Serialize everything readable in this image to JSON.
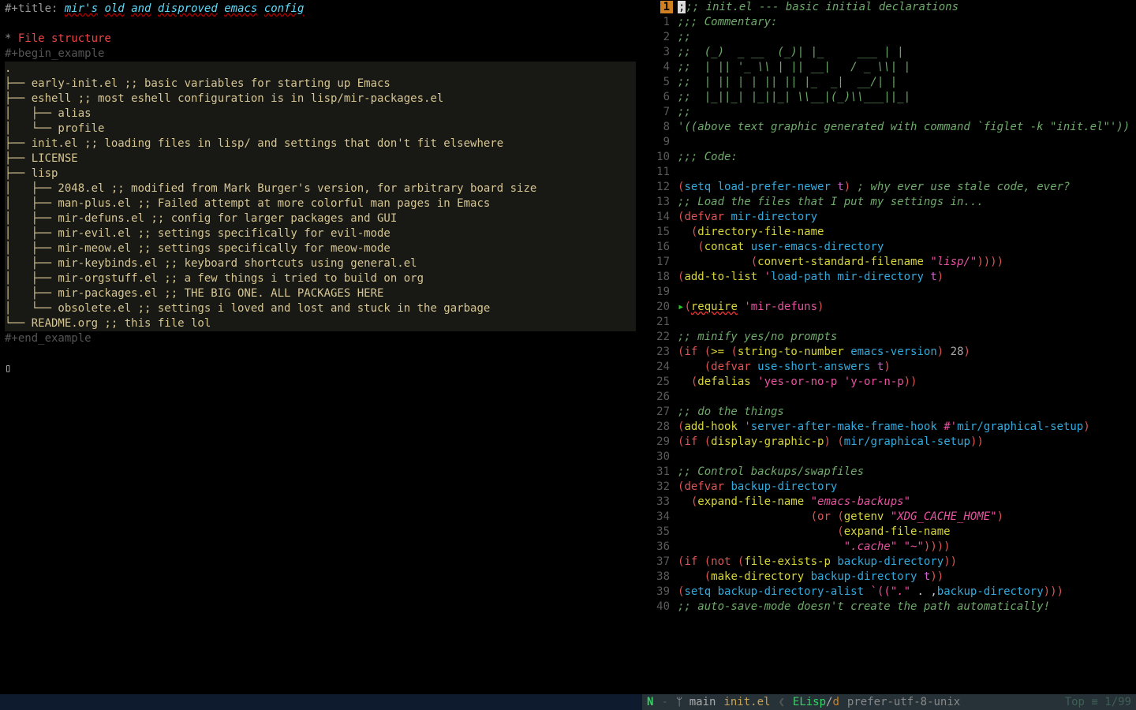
{
  "left": {
    "title_prefix": "#+title: ",
    "title_words": [
      "mir's",
      "old",
      "and",
      "disproved",
      "emacs",
      "config"
    ],
    "header_marker": "* ",
    "header": "File structure",
    "begin": "#+begin_example",
    "end": "#+end_example",
    "tree": [
      ".",
      "├── early-init.el ;; basic variables for starting up Emacs",
      "├── eshell ;; most eshell configuration is in lisp/mir-packages.el",
      "│   ├── alias",
      "│   └── profile",
      "├── init.el ;; loading files in lisp/ and settings that don't fit elsewhere",
      "├── LICENSE",
      "├── lisp",
      "│   ├── 2048.el ;; modified from Mark Burger's version, for arbitrary board size",
      "│   ├── man-plus.el ;; Failed attempt at more colorful man pages in Emacs",
      "│   ├── mir-defuns.el ;; config for larger packages and GUI",
      "│   ├── mir-evil.el ;; settings specifically for evil-mode",
      "│   ├── mir-meow.el ;; settings specifically for meow-mode",
      "│   ├── mir-keybinds.el ;; keyboard shortcuts using general.el",
      "│   ├── mir-orgstuff.el ;; a few things i tried to build on org",
      "│   ├── mir-packages.el ;; THE BIG ONE. ALL PACKAGES HERE",
      "│   └── obsolete.el ;; settings i loved and lost and stuck in the garbage",
      "└── README.org ;; this file lol"
    ],
    "cursor_glyph": "▯"
  },
  "right": {
    "badge": "1",
    "lines": [
      {
        "n": "",
        "h": "<span class='block-cursor'>;</span><span class='cmt'>;; init.el --- basic initial declarations</span>"
      },
      {
        "n": "1",
        "h": "<span class='cmt'>;;; Commentary:</span>"
      },
      {
        "n": "2",
        "h": "<span class='cmt'>;;</span>"
      },
      {
        "n": "3",
        "h": "<span class='cmt'>;;  (_)  _ __  (_)| |_     ___ | |</span>"
      },
      {
        "n": "4",
        "h": "<span class='cmt'>;;  | || '_ \\\\ | || __|   / _ \\\\| |</span>"
      },
      {
        "n": "5",
        "h": "<span class='cmt'>;;  | || | | || || |_  _|  __/| |</span>"
      },
      {
        "n": "6",
        "h": "<span class='cmt'>;;  |_||_| |_||_| \\\\__|(_)\\\\___||_|</span>"
      },
      {
        "n": "7",
        "h": "<span class='cmt'>;;</span>"
      },
      {
        "n": "8",
        "h": "<span class='cmt'>'((above text graphic generated with command `figlet -k \"init.el\"'))</span>"
      },
      {
        "n": "9",
        "h": ""
      },
      {
        "n": "10",
        "h": "<span class='cmt'>;;; Code:</span>"
      },
      {
        "n": "11",
        "h": ""
      },
      {
        "n": "12",
        "h": "<span class='p'>(</span><span class='fn'>setq</span> <span class='var'>load-prefer-newer</span> <span class='t'>t</span><span class='p'>)</span> <span class='cmt'>; why ever use stale code, ever?</span>"
      },
      {
        "n": "13",
        "h": "<span class='cmt'>;; Load the files that I put my settings in...</span>"
      },
      {
        "n": "14",
        "h": "<span class='p'>(</span><span class='kw'>defvar</span> <span class='var'>mir-directory</span>"
      },
      {
        "n": "15",
        "h": "  <span class='p'>(</span><span class='sym'>directory-file-name</span>"
      },
      {
        "n": "16",
        "h": "   <span class='p'>(</span><span class='sym'>concat</span> <span class='var'>user-emacs-directory</span>"
      },
      {
        "n": "17",
        "h": "           <span class='p'>(</span><span class='sym'>convert-standard-filename</span> <span class='str'>\"lisp/\"</span><span class='p'>))))</span>"
      },
      {
        "n": "18",
        "h": "<span class='p'>(</span><span class='sym'>add-to-list</span> <span class='sq'>'</span><span class='var'>load-path</span> <span class='var'>mir-directory</span> <span class='t'>t</span><span class='p'>)</span>"
      },
      {
        "n": "19",
        "h": ""
      },
      {
        "n": "20",
        "h": "<span class='arrow'>▸</span><span class='p'>(</span><span class='wavy sym'>require</span> <span class='sq'>'mir-defuns</span><span class='p'>)</span>"
      },
      {
        "n": "21",
        "h": ""
      },
      {
        "n": "22",
        "h": "<span class='cmt'>;; minify yes/no prompts</span>"
      },
      {
        "n": "23",
        "h": "<span class='p'>(</span><span class='kw'>if</span> <span class='p'>(</span><span class='sym'>&gt;=</span> <span class='p'>(</span><span class='sym'>string-to-number</span> <span class='var'>emacs-version</span><span class='p'>)</span> <span class='num2'>28</span><span class='p'>)</span>"
      },
      {
        "n": "24",
        "h": "    <span class='p'>(</span><span class='kw'>defvar</span> <span class='var'>use-short-answers</span> <span class='t'>t</span><span class='p'>)</span>"
      },
      {
        "n": "25",
        "h": "  <span class='p'>(</span><span class='sym'>defalias</span> <span class='sq'>'yes-or-no-p</span> <span class='sq'>'y-or-n-p</span><span class='p'>))</span>"
      },
      {
        "n": "26",
        "h": ""
      },
      {
        "n": "27",
        "h": "<span class='cmt'>;; do the things</span>"
      },
      {
        "n": "28",
        "h": "<span class='p'>(</span><span class='sym'>add-hook</span> <span class='sq'>'</span><span class='var'>server-after-make-frame-hook</span> <span class='sq'>#'</span><span class='var'>mir/graphical-setup</span><span class='p'>)</span>"
      },
      {
        "n": "29",
        "h": "<span class='p'>(</span><span class='kw'>if</span> <span class='p'>(</span><span class='sym'>display-graphic-p</span><span class='p'>)</span> <span class='p'>(</span><span class='var'>mir/graphical-setup</span><span class='p'>))</span>"
      },
      {
        "n": "30",
        "h": ""
      },
      {
        "n": "31",
        "h": "<span class='cmt'>;; Control backups/swapfiles</span>"
      },
      {
        "n": "32",
        "h": "<span class='p'>(</span><span class='kw'>defvar</span> <span class='var'>backup-directory</span>"
      },
      {
        "n": "33",
        "h": "  <span class='p'>(</span><span class='sym'>expand-file-name</span> <span class='str'>\"emacs-backups\"</span>"
      },
      {
        "n": "34",
        "h": "                    <span class='p'>(</span><span class='kw'>or</span> <span class='p'>(</span><span class='sym'>getenv</span> <span class='str'>\"XDG_CACHE_HOME\"</span><span class='p'>)</span>"
      },
      {
        "n": "35",
        "h": "                        <span class='p'>(</span><span class='sym'>expand-file-name</span>"
      },
      {
        "n": "36",
        "h": "                         <span class='str'>\".cache\"</span> <span class='str'>\"~\"</span><span class='p'>))))</span>"
      },
      {
        "n": "37",
        "h": "<span class='p'>(</span><span class='kw'>if</span> <span class='p'>(</span><span class='kw'>not</span> <span class='p'>(</span><span class='sym'>file-exists-p</span> <span class='var'>backup-directory</span><span class='p'>))</span>"
      },
      {
        "n": "38",
        "h": "    <span class='p'>(</span><span class='sym'>make-directory</span> <span class='var'>backup-directory</span> <span class='t'>t</span><span class='p'>))</span>"
      },
      {
        "n": "39",
        "h": "<span class='p'>(</span><span class='fn'>setq</span> <span class='var'>backup-directory-alist</span> <span class='sq'>`((</span><span class='str'>\".\"</span> . ,<span class='var'>backup-directory</span><span class='p'>)))</span>"
      },
      {
        "n": "40",
        "h": "<span class='cmt'>;; auto-save-mode doesn't create the path automatically!</span>"
      }
    ]
  },
  "modeline": {
    "evil": "N",
    "dash": "-",
    "branch_icon": "ᛘ",
    "branch": "main",
    "fname": "init.el",
    "sep": "❮",
    "major": "ELisp",
    "slash": "/",
    "minor": "d",
    "encoding": "prefer-utf-8-unix",
    "pos": "Top ≡ 1/99"
  }
}
